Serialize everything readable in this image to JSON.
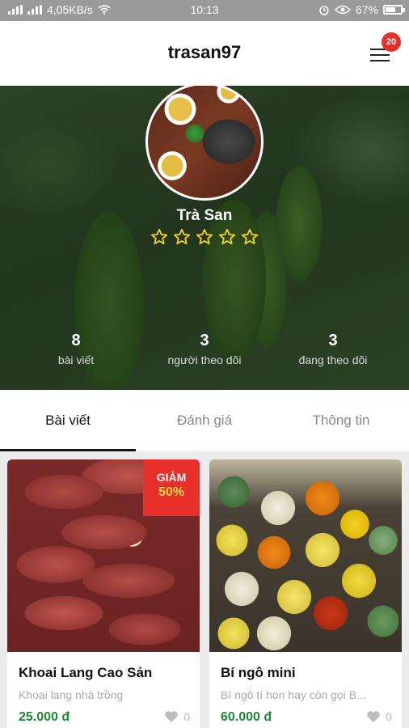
{
  "status_bar": {
    "network_speed": "4,05KB/s",
    "time": "10:13",
    "battery": "67%",
    "battery_level": 0.67
  },
  "header": {
    "title": "trasan97",
    "notification_count": "20",
    "menu_icon": "hamburger-menu-icon"
  },
  "profile": {
    "name": "Trà San",
    "rating_stars": 0,
    "rating_max": 5,
    "star_color": "#f5d21c",
    "stats": [
      {
        "value": "8",
        "label": "bài viết"
      },
      {
        "value": "3",
        "label": "người theo dõi"
      },
      {
        "value": "3",
        "label": "đang theo dõi"
      }
    ]
  },
  "tabs": [
    {
      "label": "Bài viết",
      "active": true
    },
    {
      "label": "Đánh giá",
      "active": false
    },
    {
      "label": "Thông tin",
      "active": false
    }
  ],
  "products": [
    {
      "name": "Khoai Lang Cao Sản",
      "description": "Khoai lang nhà trồng",
      "price": "25.000 đ",
      "likes": "0",
      "discount_label": "GIẢM",
      "discount_value": "50%"
    },
    {
      "name": "Bí ngô mini",
      "description": "Bí ngô tí hon hay còn gọi B...",
      "price": "60.000 đ",
      "likes": "0"
    }
  ],
  "colors": {
    "accent_red": "#e8302a",
    "price_green": "#1d8a34",
    "discount_yellow": "#ffd54a"
  }
}
